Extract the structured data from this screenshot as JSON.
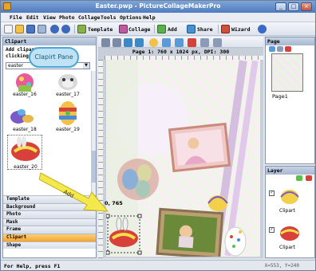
{
  "window": {
    "title": "Easter.pwp - PictureCollageMakerPro",
    "minimize": "_",
    "maximize": "□",
    "close": "×"
  },
  "menu": [
    "File",
    "Edit",
    "View",
    "Photo",
    "Collage",
    "Tools",
    "Options",
    "Help"
  ],
  "toolbar": {
    "template_label": "Template",
    "collage_label": "Collage",
    "add_label": "Add",
    "share_label": "Share",
    "wizard_label": "Wizard"
  },
  "clipart_panel": {
    "title": "Clipart",
    "help_text": "Add clipart... double clicking on it.",
    "category_selected": "easter",
    "thumbnails": [
      {
        "label": "easter_16"
      },
      {
        "label": "easter_17"
      },
      {
        "label": "easter_18"
      },
      {
        "label": "easter_19"
      },
      {
        "label": "easter_20"
      }
    ]
  },
  "bubble": {
    "text": "Clapirt Pane"
  },
  "categories": [
    {
      "label": "Template",
      "active": false
    },
    {
      "label": "Background",
      "active": false
    },
    {
      "label": "Photo",
      "active": false
    },
    {
      "label": "Mask",
      "active": false
    },
    {
      "label": "Frame",
      "active": false
    },
    {
      "label": "Clipart",
      "active": true
    },
    {
      "label": "Shape",
      "active": false
    }
  ],
  "canvas": {
    "info": "Page 1: 760 x 1024 px, DPI: 300",
    "coord": "0, 765"
  },
  "annotation": {
    "arrow_label": "Add"
  },
  "page_panel": {
    "title": "Page",
    "page_label": "Page1"
  },
  "layer_panel": {
    "title": "Layer",
    "layers": [
      {
        "label": "Clipart"
      },
      {
        "label": "Clipart"
      }
    ]
  },
  "status": {
    "left": "For Help, press F1",
    "right": "X=553, Y=240"
  },
  "colors": {
    "accent": "#f5a42a",
    "title_bar": "#4f7cc0",
    "bubble": "#bfe3f5",
    "arrow": "#f3e94a"
  }
}
